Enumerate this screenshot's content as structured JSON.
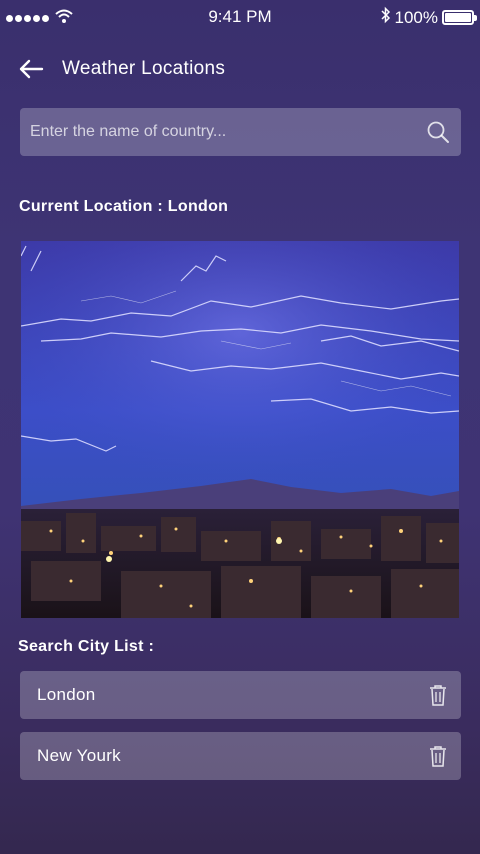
{
  "status_bar": {
    "time": "9:41 PM",
    "battery": "100%",
    "signal_icon": "signal-dots-icon",
    "wifi_icon": "wifi-icon",
    "bluetooth_icon": "bluetooth-icon",
    "battery_icon": "battery-icon"
  },
  "header": {
    "back_icon": "arrow-left-icon",
    "title": "Weather Locations"
  },
  "search": {
    "placeholder": "Enter the name of country...",
    "value": "",
    "icon": "search-icon"
  },
  "current_location": {
    "label": "Current Location : London"
  },
  "city_list": {
    "label": "Search City List :",
    "items": [
      {
        "name": "London",
        "icon": "trash-icon"
      },
      {
        "name": "New Yourk",
        "icon": "trash-icon"
      }
    ]
  },
  "colors": {
    "background_top": "#3a2f6d",
    "background_bottom": "#34284f",
    "text": "#ffffff",
    "field_bg": "rgba(255,255,255,0.24)"
  }
}
